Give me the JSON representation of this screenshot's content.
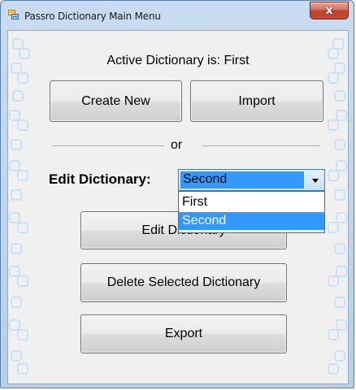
{
  "window": {
    "title": "Passro Dictionary Main Menu",
    "close_glyph": "x"
  },
  "main": {
    "active_dictionary_text": "Active Dictionary is: First",
    "create_new_label": "Create New",
    "import_label": "Import",
    "or_label": "or",
    "edit_dictionary_label": "Edit Dictionary:",
    "selected_dictionary": "Second",
    "dictionary_options": [
      "First",
      "Second"
    ],
    "edit_button_label": "Edit Dictionary",
    "delete_button_label": "Delete Selected Dictionary",
    "export_button_label": "Export"
  },
  "icons": {
    "app": "app-icon",
    "close": "close-icon",
    "dropdown": "chevron-down-icon"
  },
  "colors": {
    "selection": "#3399ff",
    "client_background": "#f0f0f0",
    "frame": "#c9dcf1",
    "close_button": "#c1402c",
    "decoration": "#c8e2f7"
  }
}
